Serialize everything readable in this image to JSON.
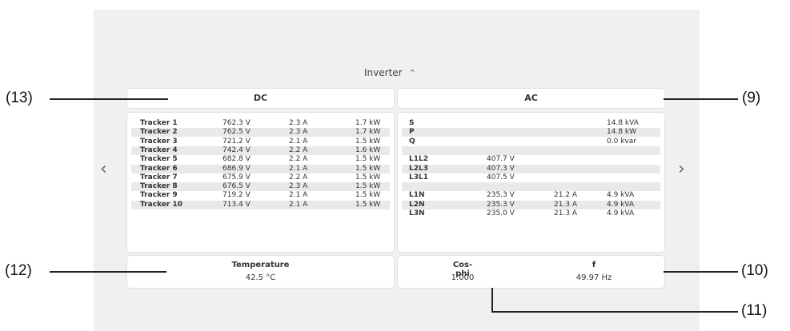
{
  "inverter": {
    "title": "Inverter",
    "toggle_icon": "chevron-up-icon"
  },
  "dc": {
    "title": "DC",
    "rows": [
      {
        "name": "Tracker 1",
        "voltage": "762.3 V",
        "current": "2.3 A",
        "power": "1.7 kW"
      },
      {
        "name": "Tracker 2",
        "voltage": "762.5 V",
        "current": "2.3 A",
        "power": "1.7 kW"
      },
      {
        "name": "Tracker 3",
        "voltage": "721.2 V",
        "current": "2.1 A",
        "power": "1.5 kW"
      },
      {
        "name": "Tracker 4",
        "voltage": "742.4 V",
        "current": "2.2 A",
        "power": "1.6 kW"
      },
      {
        "name": "Tracker 5",
        "voltage": "682.8 V",
        "current": "2.2 A",
        "power": "1.5 kW"
      },
      {
        "name": "Tracker 6",
        "voltage": "686.9 V",
        "current": "2.1 A",
        "power": "1.5 kW"
      },
      {
        "name": "Tracker 7",
        "voltage": "675.9 V",
        "current": "2.2 A",
        "power": "1.5 kW"
      },
      {
        "name": "Tracker 8",
        "voltage": "676.5 V",
        "current": "2.3 A",
        "power": "1.5 kW"
      },
      {
        "name": "Tracker 9",
        "voltage": "719.2 V",
        "current": "2.1 A",
        "power": "1.5 kW"
      },
      {
        "name": "Tracker 10",
        "voltage": "713.4 V",
        "current": "2.1 A",
        "power": "1.5 kW"
      }
    ]
  },
  "ac": {
    "title": "AC",
    "rows": [
      {
        "name": "S",
        "voltage": "",
        "current": "",
        "power": "14.8 kVA"
      },
      {
        "name": "P",
        "voltage": "",
        "current": "",
        "power": "14.8 kW"
      },
      {
        "name": "Q",
        "voltage": "",
        "current": "",
        "power": "0.0 kvar"
      },
      {
        "name": "",
        "voltage": "",
        "current": "",
        "power": ""
      },
      {
        "name": "L1L2",
        "voltage": "407.7 V",
        "current": "",
        "power": ""
      },
      {
        "name": "L2L3",
        "voltage": "407.3 V",
        "current": "",
        "power": ""
      },
      {
        "name": "L3L1",
        "voltage": "407.5 V",
        "current": "",
        "power": ""
      },
      {
        "name": "",
        "voltage": "",
        "current": "",
        "power": ""
      },
      {
        "name": "L1N",
        "voltage": "235.3 V",
        "current": "21.2 A",
        "power": "4.9 kVA"
      },
      {
        "name": "L2N",
        "voltage": "235.3 V",
        "current": "21.3 A",
        "power": "4.9 kVA"
      },
      {
        "name": "L3N",
        "voltage": "235.0 V",
        "current": "21.3 A",
        "power": "4.9 kVA"
      }
    ]
  },
  "temperature": {
    "label": "Temperature",
    "value": "42.5 °C"
  },
  "cosphi": {
    "label": "Cos-phi",
    "value": "1.000"
  },
  "frequency": {
    "label": "f",
    "value": "49.97 Hz"
  },
  "nav": {
    "prev_icon": "chevron-left-icon",
    "next_icon": "chevron-right-icon"
  },
  "callouts": {
    "dc": "(13)",
    "ac": "(9)",
    "temperature": "(12)",
    "frequency": "(10)",
    "cosphi": "(11)"
  }
}
